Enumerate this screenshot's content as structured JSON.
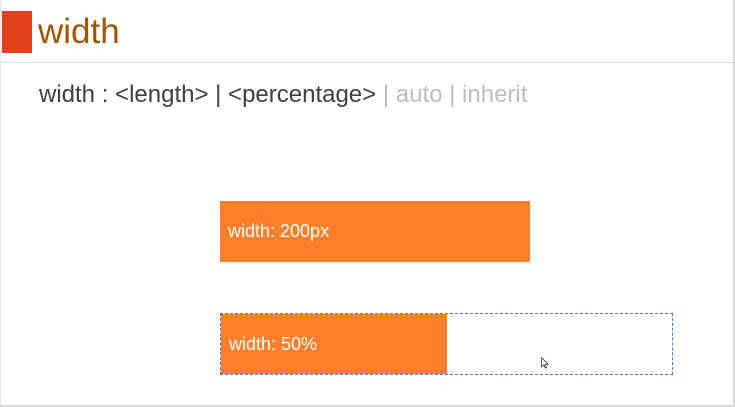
{
  "slide": {
    "title": "width"
  },
  "syntax": {
    "property": "width",
    "separator": " : ",
    "length": "<length>",
    "pipe1": " | ",
    "percentage": "<percentage>",
    "pipe2": " | ",
    "auto": "auto",
    "pipe3": " | ",
    "inherit": "inherit"
  },
  "demos": {
    "fixed": {
      "label": "width: 200px"
    },
    "percent": {
      "label": "width: 50%",
      "fill_fraction": 0.5
    }
  },
  "icons": {
    "cursor": "mouse-pointer-icon"
  },
  "colors": {
    "title_marker": "#e2401c",
    "title_text": "#a35306",
    "syntax_active": "#3f3f3f",
    "syntax_muted": "#bdbdbd",
    "demo_fill": "#ff7f2a",
    "container_border": "#4a72c8"
  }
}
